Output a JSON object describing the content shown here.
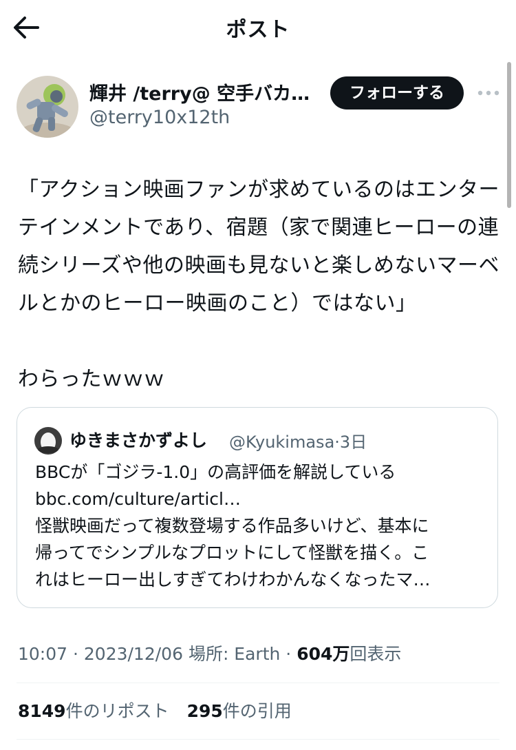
{
  "header": {
    "title": "ポスト",
    "back_icon": "arrow-left-icon"
  },
  "author": {
    "display_name": "輝井 /terry@ 空手バカ…",
    "handle": "@terry10x12th",
    "follow_label": "フォローする"
  },
  "tweet": {
    "text": "「アクション映画ファンが求めているのはエンターテインメントであり、宿題（家で関連ヒーローの連続シリーズや他の映画も見ないと楽しめないマーベルとかのヒーロー映画のこと）ではない」\n\nわらったｗｗｗ"
  },
  "quote": {
    "name": "ゆきまさかずよし",
    "handle": "@Kyukimasa",
    "sep": "·",
    "time": "3日",
    "lines": [
      "BBCが「ゴジラ-1.0」の高評価を解説している",
      "bbc.com/culture/articl…",
      "怪獣映画だって複数登場する作品多いけど、基本に",
      "帰ってでシンプルなプロットにして怪獣を描く。こ",
      "れはヒーロー出しすぎてわけわかんなくなったマ…"
    ]
  },
  "meta": {
    "time": "10:07",
    "sep": " · ",
    "date": "2023/12/06",
    "location": "場所: Earth",
    "views_num": "604万",
    "views_label": "回表示"
  },
  "stats": {
    "reposts_num": "8149",
    "reposts_label": "件のリポスト",
    "quotes_num": "295",
    "quotes_label": "件の引用"
  }
}
